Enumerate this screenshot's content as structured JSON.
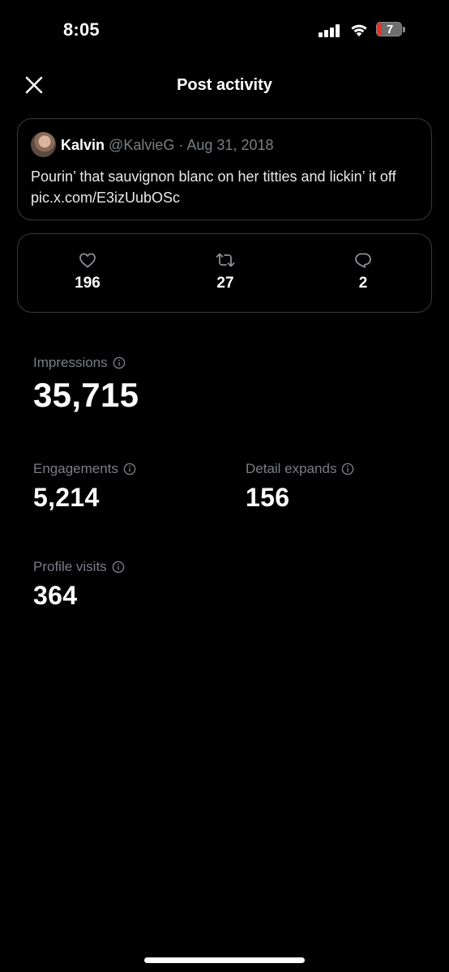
{
  "status_bar": {
    "time": "8:05",
    "battery_level": "7"
  },
  "header": {
    "title": "Post activity"
  },
  "post": {
    "author_name": "Kalvin",
    "author_handle": "@KalvieG",
    "separator": "·",
    "date": "Aug 31, 2018",
    "text": "Pourin’ that sauvignon blanc on her titties and lickin’ it off pic.x.com/E3izUubOSc"
  },
  "counts": {
    "likes": "196",
    "reposts": "27",
    "replies": "2"
  },
  "metrics": {
    "impressions": {
      "label": "Impressions",
      "value": "35,715"
    },
    "engagements": {
      "label": "Engagements",
      "value": "5,214"
    },
    "detail_expands": {
      "label": "Detail expands",
      "value": "156"
    },
    "profile_visits": {
      "label": "Profile visits",
      "value": "364"
    }
  },
  "colors": {
    "background": "#000000",
    "text_primary": "#ffffff",
    "text_secondary": "#7a7f84",
    "border": "#3a3a3a",
    "battery_low": "#e5322a"
  },
  "icons": [
    "close-icon",
    "heart-icon",
    "repost-icon",
    "reply-icon",
    "info-icon",
    "signal-icon",
    "wifi-icon",
    "battery-icon"
  ]
}
